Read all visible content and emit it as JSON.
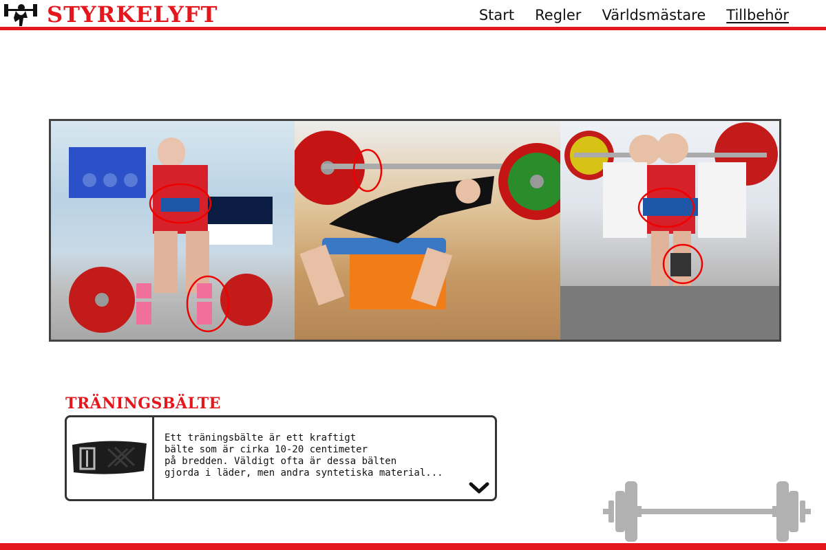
{
  "site": {
    "title": "STYRKELYFT",
    "accent": "#e4171c"
  },
  "nav": {
    "items": [
      {
        "label": "Start",
        "active": false
      },
      {
        "label": "Regler",
        "active": false
      },
      {
        "label": "Världsmästare",
        "active": false
      },
      {
        "label": "Tillbehör",
        "active": true
      }
    ]
  },
  "hero": {
    "photos": [
      {
        "icon": "deadlift-photo"
      },
      {
        "icon": "benchpress-photo"
      },
      {
        "icon": "squat-photo"
      }
    ]
  },
  "section": {
    "title": "TRÄNINGSBÄLTE",
    "text": "Ett träningsbälte är ett kraftigt\nbälte som är cirka 10-20 centimeter\npå bredden. Väldigt ofta är dessa bälten\ngjorda i läder, men andra syntetiska material..."
  },
  "icons": {
    "logo": "lifter-logo-icon",
    "expand": "chevron-down-icon",
    "decoration": "barbell-icon"
  }
}
